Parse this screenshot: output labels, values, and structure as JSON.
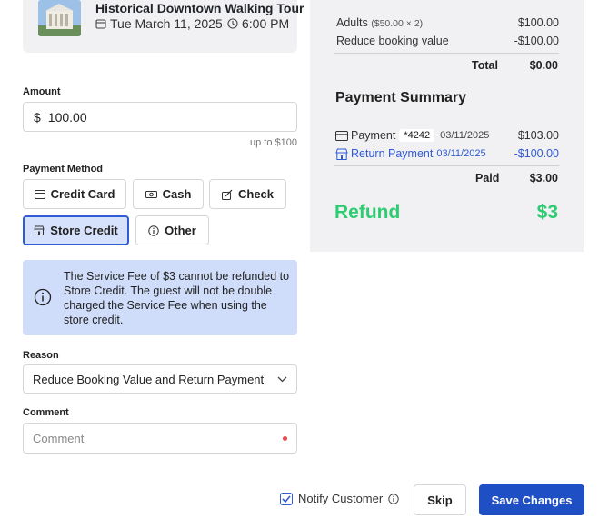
{
  "tour": {
    "title": "Historical Downtown Walking Tour",
    "date": "Tue March 11, 2025",
    "time": "6:00 PM",
    "thumb_icon": "building-photo"
  },
  "amount": {
    "label": "Amount",
    "currency": "$",
    "value": "100.00",
    "hint": "up to $100"
  },
  "payment_method": {
    "label": "Payment Method",
    "options": [
      {
        "label": "Credit Card",
        "icon": "credit-card-icon",
        "selected": false
      },
      {
        "label": "Cash",
        "icon": "cash-icon",
        "selected": false
      },
      {
        "label": "Check",
        "icon": "check-icon",
        "selected": false
      },
      {
        "label": "Store Credit",
        "icon": "store-icon",
        "selected": true
      },
      {
        "label": "Other",
        "icon": "info-icon",
        "selected": false
      }
    ]
  },
  "info_notice": {
    "text": "The Service Fee of $3 cannot be refunded to Store Credit. The guest will not be double charged the Service Fee when using the store credit."
  },
  "reason": {
    "label": "Reason",
    "selected": "Reduce Booking Value and Return Payment"
  },
  "comment": {
    "label": "Comment",
    "placeholder": "Comment"
  },
  "summary": {
    "line_items": [
      {
        "label": "Adults",
        "detail": "($50.00 × 2)",
        "amount": "$100.00"
      },
      {
        "label": "Reduce booking value",
        "detail": "",
        "amount": "-$100.00"
      }
    ],
    "total_label": "Total",
    "total_value": "$0.00"
  },
  "payment_summary": {
    "title": "Payment Summary",
    "payments": [
      {
        "label": "Payment",
        "card": "*4242",
        "date": "03/11/2025",
        "amount": "$103.00"
      },
      {
        "label": "Return Payment",
        "date": "03/11/2025",
        "amount": "-$100.00"
      }
    ],
    "paid_label": "Paid",
    "paid_value": "$3.00",
    "refund_label": "Refund",
    "refund_value": "$3"
  },
  "footer": {
    "notify_label": "Notify Customer",
    "notify_checked": true,
    "skip_label": "Skip",
    "save_label": "Save Changes"
  },
  "colors": {
    "primary": "#1f4fc4",
    "selected_bg": "#d6e2fb",
    "info_bg": "#cfddfa",
    "refund_green": "#2ecc71",
    "panel_bg": "#f1f1f3"
  }
}
